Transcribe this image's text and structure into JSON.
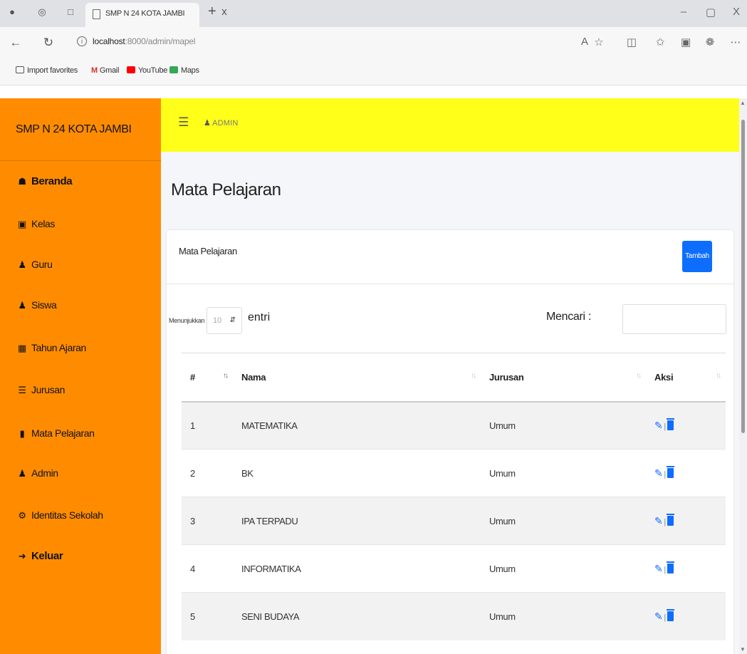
{
  "browser": {
    "tab_title": "SMP N 24 KOTA JAMBI",
    "tab_close": "x",
    "new_tab": "+",
    "url_host": "localhost",
    "url_rest": ":8000/admin/mapel",
    "minimize": "–",
    "maximize": "▢",
    "close": "X",
    "favorites": [
      {
        "label": "Import favorites",
        "icon": "import-icon",
        "color": "#555555"
      },
      {
        "label": "Gmail",
        "icon": "gmail-icon",
        "color": "#d93025"
      },
      {
        "label": "YouTube",
        "icon": "youtube-icon",
        "color": "#ff0000"
      },
      {
        "label": "Maps",
        "icon": "maps-icon",
        "color": "#34a853"
      }
    ]
  },
  "app": {
    "brand": "SMP N 24 KOTA JAMBI",
    "user": "ADMIN",
    "colors": {
      "sidebar": "#ff8c00",
      "topbar": "#ffff19",
      "primary": "#0d6efd"
    }
  },
  "sidebar": {
    "items": [
      {
        "label": "Beranda",
        "icon": "home-icon"
      },
      {
        "label": "Kelas",
        "icon": "inbox-icon"
      },
      {
        "label": "Guru",
        "icon": "user-icon"
      },
      {
        "label": "Siswa",
        "icon": "user-icon"
      },
      {
        "label": "Tahun Ajaran",
        "icon": "calendar-icon"
      },
      {
        "label": "Jurusan",
        "icon": "list-icon"
      },
      {
        "label": "Mata Pelajaran",
        "icon": "book-icon"
      },
      {
        "label": "Admin",
        "icon": "user-icon"
      },
      {
        "label": "Identitas Sekolah",
        "icon": "gear-icon"
      },
      {
        "label": "Keluar",
        "icon": "sign-out-icon"
      }
    ]
  },
  "main": {
    "page_title": "Mata Pelajaran",
    "card_title": "Mata Pelajaran",
    "add_button": "Tambah",
    "show_label": "Menunjukkan",
    "show_value": "10",
    "entries_label": "entri",
    "search_label": "Mencari :",
    "table": {
      "columns": [
        "#",
        "Nama",
        "Jurusan",
        "Aksi"
      ],
      "rows": [
        {
          "no": "1",
          "nama": "MATEMATIKA",
          "jurusan": "Umum"
        },
        {
          "no": "2",
          "nama": "BK",
          "jurusan": "Umum"
        },
        {
          "no": "3",
          "nama": "IPA TERPADU",
          "jurusan": "Umum"
        },
        {
          "no": "4",
          "nama": "INFORMATIKA",
          "jurusan": "Umum"
        },
        {
          "no": "5",
          "nama": "SENI BUDAYA",
          "jurusan": "Umum"
        }
      ]
    }
  }
}
